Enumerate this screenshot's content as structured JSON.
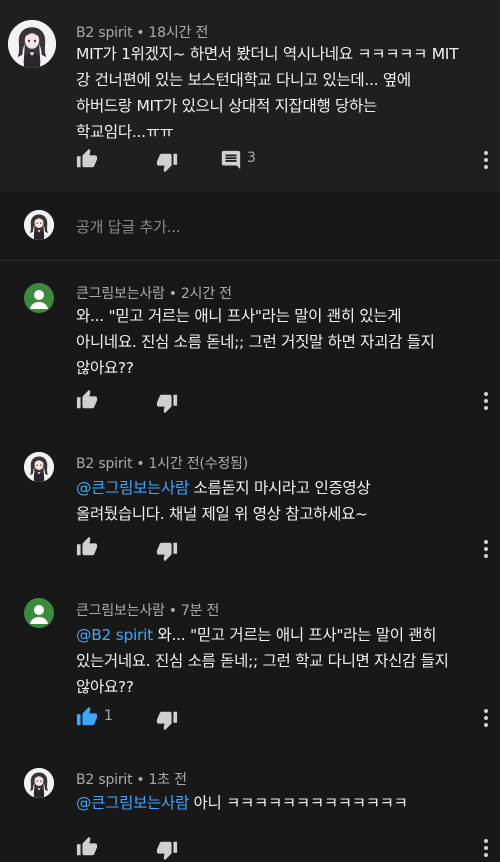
{
  "comments": [
    {
      "author": "B2 spirit",
      "time": "18시간 전",
      "lines": [
        "MIT가 1위겠지~ 하면서 봤더니 역시나네요 ㅋㅋㅋㅋㅋ MIT",
        "강 건너편에 있는 보스턴대학교 다니고 있는데... 옆에",
        "하버드랑 MIT가 있으니 상대적 지잡대행 당하는",
        "학교임다...ㅠㅠ"
      ],
      "reply_count": "3"
    }
  ],
  "reply_box": {
    "placeholder": "공개 답글 추가..."
  },
  "replies": [
    {
      "author": "큰그림보는사람",
      "time": "2시간 전",
      "lines": [
        "와... \"믿고 거르는 애니 프사\"라는 말이 괜히 있는게",
        "아니네요. 진심 소름 돋네;; 그런 거짓말 하면 자괴감 들지",
        "않아요??"
      ]
    },
    {
      "author": "B2 spirit",
      "time": "1시간 전(수정됨)",
      "mention": "@큰그림보는사람",
      "first_rest": " 소름돋지 마시라고 인증영상",
      "lines": [
        "올려뒀습니다. 채널 제일 위 영상 참고하세요~"
      ]
    },
    {
      "author": "큰그림보는사람",
      "time": "7분 전",
      "mention": "@B2 spirit",
      "first_rest": " 와... \"믿고 거르는 애니 프사\"라는 말이 괜히",
      "lines": [
        "있는거네요. 진심 소름 돋네;; 그런 학교 다니면 자신감 들지",
        "않아요??"
      ],
      "like_count": "1"
    },
    {
      "author": "B2 spirit",
      "time": "1초 전",
      "mention": "@큰그림보는사람",
      "first_rest": " 아니 ㅋㅋㅋㅋㅋㅋㅋㅋㅋㅋㅋㅋㅋ"
    }
  ],
  "separator": "•",
  "icons": [
    "thumb-up-icon",
    "thumb-down-icon",
    "comment-icon",
    "more-vert-icon"
  ],
  "colors": {
    "background": "#181818",
    "mention": "#3ea6ff",
    "like_active": "#3ea6ff"
  }
}
